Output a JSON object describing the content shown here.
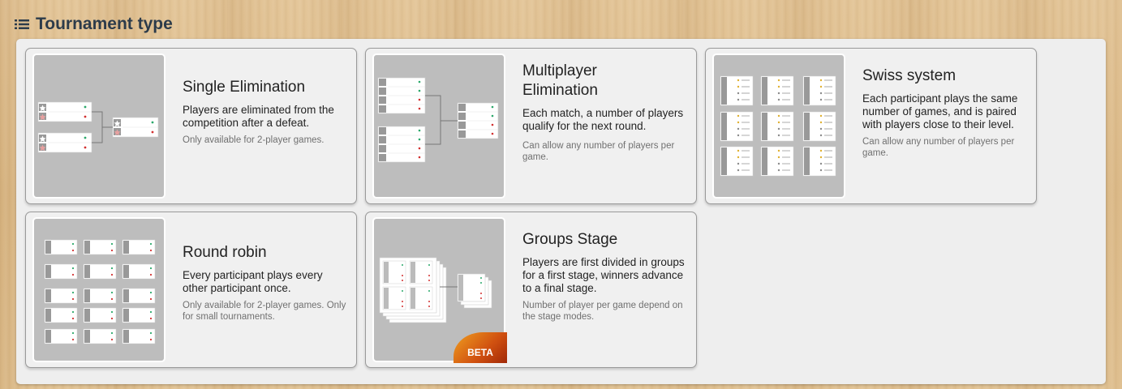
{
  "header": {
    "title": "Tournament type",
    "icon": "list-icon"
  },
  "cards": [
    {
      "title": "Single Elimination",
      "description": "Players are eliminated from the competition after a defeat.",
      "note": "Only available for 2-player games."
    },
    {
      "title": "Multiplayer Elimination",
      "description": "Each match, a number of players qualify for the next round.",
      "note": "Can allow any number of players per game."
    },
    {
      "title": "Swiss system",
      "description": "Each participant plays the same number of games, and is paired with players close to their level.",
      "note": "Can allow any number of players per game."
    },
    {
      "title": "Round robin",
      "description": "Every participant plays every other participant once.",
      "note": "Only available for 2-player games. Only for small tournaments."
    },
    {
      "title": "Groups Stage",
      "description": "Players are first divided in groups for a first stage, winners advance to a final stage.",
      "note": "Number of player per game depend on the stage modes.",
      "badge": "BETA"
    }
  ],
  "colors": {
    "header_text": "#2c3b4a",
    "thumb_bg": "#bdbdbd",
    "win_dot": "#2aa86a",
    "loss_dot": "#d23030",
    "badge": "#d05010"
  }
}
